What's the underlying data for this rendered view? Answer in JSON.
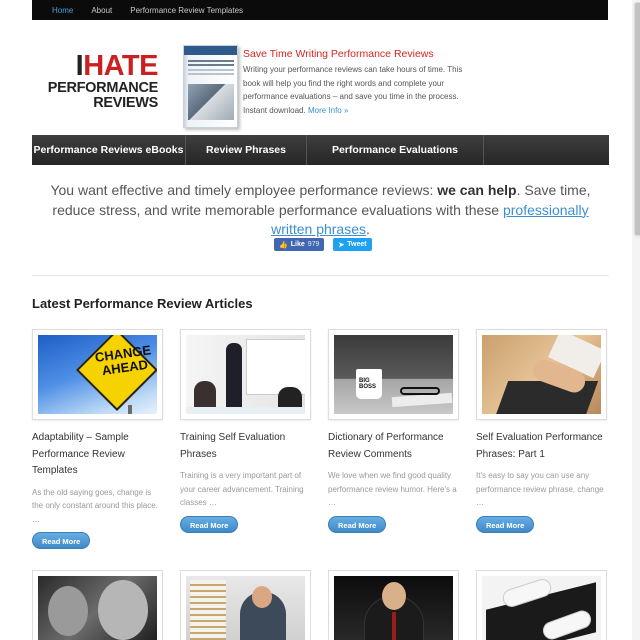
{
  "topnav": {
    "items": [
      "Home",
      "About",
      "Performance Review Templates"
    ]
  },
  "logo": {
    "line1_i": "I",
    "line1_rest": "HATE",
    "line2": "PERFORMANCE",
    "line3": "REVIEWS"
  },
  "promo": {
    "title": "Save Time Writing Performance Reviews",
    "body": "Writing your performance reviews can take hours of time. This book will help you find the right words and complete your performance evaluations – and save you time in the process. Instant download.",
    "more_link": "More Info »"
  },
  "mainnav": {
    "items": [
      "Performance Reviews eBooks",
      "Review Phrases",
      "Performance Evaluations"
    ]
  },
  "intro": {
    "part1": "You want effective and timely employee performance reviews: ",
    "bold": "we can help",
    "part2": ". Save time, reduce stress, and write memorable performance evaluations with these ",
    "link": "professionally written phrases",
    "part3": "."
  },
  "social": {
    "like_label": "Like",
    "like_count": "979",
    "tweet_label": "Tweet"
  },
  "articles": {
    "heading": "Latest Performance Review Articles",
    "image_text": {
      "change_ahead": "CHANGE AHEAD",
      "mug": "BIG BOSS"
    },
    "items": [
      {
        "title": "Adaptability – Sample Performance Review Templates",
        "excerpt": "As the old saying goes, change is the only constant around this place. …",
        "button": "Read More"
      },
      {
        "title": "Training Self Evaluation Phrases",
        "excerpt": "Training is a very important part of your career advancement. Training classes …",
        "button": "Read More"
      },
      {
        "title": "Dictionary of Performance Review Comments",
        "excerpt": "We love when we find good quality performance review humor. Here's a …",
        "button": "Read More"
      },
      {
        "title": "Self Evaluation Performance Phrases: Part 1",
        "excerpt": "It's easy to say you can use any performance review phrase, change …",
        "button": "Read More"
      }
    ]
  },
  "colors": {
    "accent": "#3d8fd1",
    "promo_title": "#d8241e",
    "nav_bg": "#2e2e2e",
    "topbar_bg": "#0b0b0b"
  }
}
